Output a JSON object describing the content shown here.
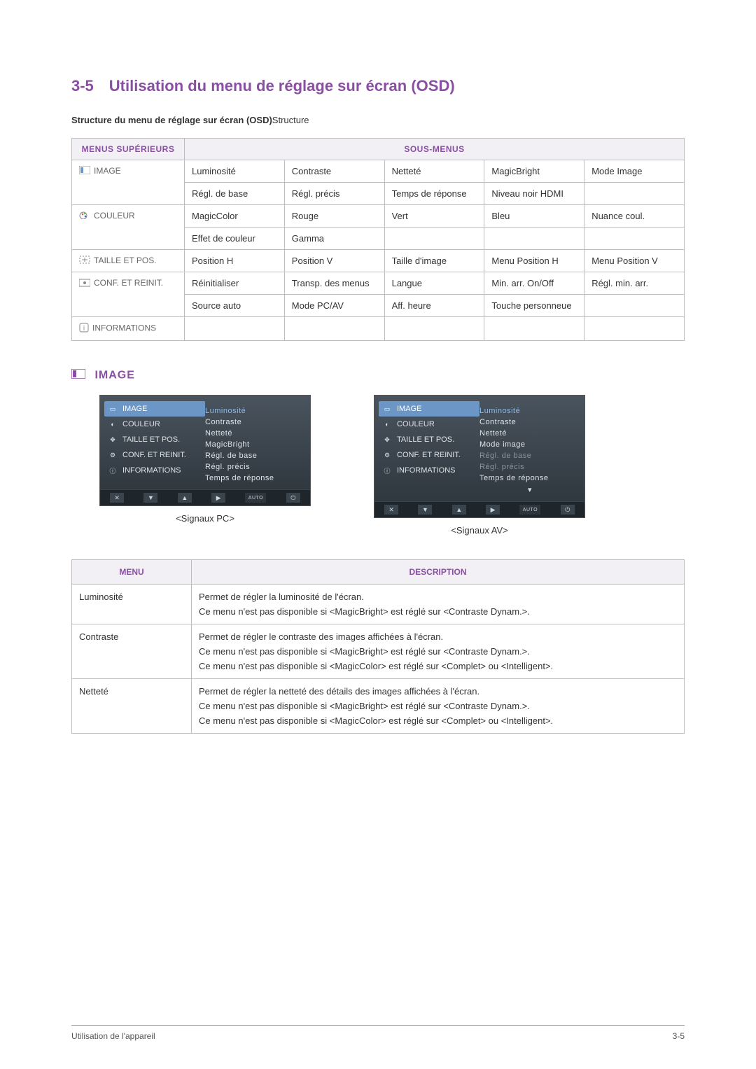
{
  "section": {
    "number": "3-5",
    "title": "Utilisation du menu de réglage sur écran (OSD)"
  },
  "structure_line": {
    "bold": "Structure du menu de réglage sur écran (OSD)",
    "rest": "Structure"
  },
  "table1": {
    "head_menus": "MENUS SUPÉRIEURS",
    "head_sub": "SOUS-MENUS",
    "rows": [
      {
        "menu": "IMAGE",
        "cells": [
          "Luminosité",
          "Contraste",
          "Netteté",
          "MagicBright",
          "Mode Image"
        ]
      },
      {
        "menu": "",
        "cells": [
          "Régl. de base",
          "Régl. précis",
          "Temps de réponse",
          "Niveau noir HDMI",
          ""
        ]
      },
      {
        "menu": "COULEUR",
        "cells": [
          "MagicColor",
          "Rouge",
          "Vert",
          "Bleu",
          "Nuance coul."
        ]
      },
      {
        "menu": "",
        "cells": [
          "Effet de couleur",
          "Gamma",
          "",
          "",
          ""
        ]
      },
      {
        "menu": "TAILLE ET POS.",
        "cells": [
          "Position H",
          "Position V",
          "Taille d'image",
          "Menu Position H",
          "Menu Position V"
        ]
      },
      {
        "menu": "CONF. ET REINIT.",
        "cells": [
          "Réinitialiser",
          "Transp. des menus",
          "Langue",
          "Min. arr. On/Off",
          "Régl. min. arr."
        ]
      },
      {
        "menu": "",
        "cells": [
          "Source auto",
          "Mode PC/AV",
          "Aff. heure",
          "Touche personneue",
          ""
        ]
      },
      {
        "menu": "INFORMATIONS",
        "cells": [
          "",
          "",
          "",
          "",
          ""
        ]
      }
    ]
  },
  "image_heading": "IMAGE",
  "osd_left_items": [
    "IMAGE",
    "COULEUR",
    "TAILLE ET POS.",
    "CONF. ET REINIT.",
    "INFORMATIONS"
  ],
  "osd_screens": [
    {
      "caption": "<Signaux PC>",
      "right": [
        "Luminosité",
        "Contraste",
        "Netteté",
        "MagicBright",
        "Régl. de base",
        "Régl. précis",
        "Temps de réponse"
      ],
      "dim_indices": []
    },
    {
      "caption": "<Signaux AV>",
      "right": [
        "Luminosité",
        "Contraste",
        "Netteté",
        "Mode image",
        "Régl. de base",
        "Régl. précis",
        "Temps de réponse"
      ],
      "dim_indices": [
        4,
        5
      ]
    }
  ],
  "osd_nav_auto": "AUTO",
  "table2": {
    "head_menu": "MENU",
    "head_desc": "DESCRIPTION",
    "rows": [
      {
        "menu": "Luminosité",
        "desc": [
          "Permet de régler la luminosité de l'écran.",
          "Ce menu n'est pas disponible si <MagicBright> est réglé sur <Contraste Dynam.>."
        ]
      },
      {
        "menu": "Contraste",
        "desc": [
          "Permet de régler le contraste des images affichées à l'écran.",
          "Ce menu n'est pas disponible si <MagicBright> est réglé sur <Contraste Dynam.>.",
          "Ce menu n'est pas disponible si <MagicColor> est réglé sur <Complet> ou <Intelligent>."
        ]
      },
      {
        "menu": "Netteté",
        "desc": [
          "Permet de régler la netteté des détails des images affichées à l'écran.",
          "Ce menu n'est pas disponible si <MagicBright> est réglé sur <Contraste Dynam.>.",
          "Ce menu n'est pas disponible si <MagicColor> est réglé sur <Complet> ou <Intelligent>."
        ]
      }
    ]
  },
  "footer": {
    "left": "Utilisation de l'appareil",
    "right": "3-5"
  }
}
